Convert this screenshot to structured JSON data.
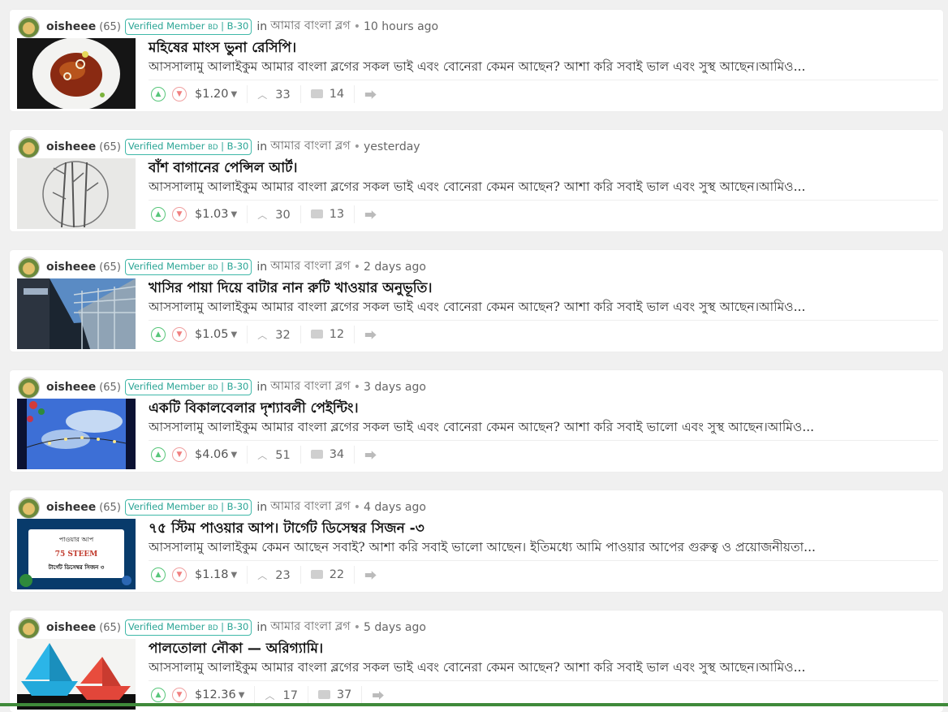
{
  "posts": [
    {
      "author": "oisheee",
      "rep": "(65)",
      "badge_main": "Verified Member ",
      "badge_small": "BD",
      "badge_tail": " | B-30",
      "in": "in",
      "community": "আমার বাংলা ব্লগ",
      "time": "10 hours ago",
      "title": "মহিষের মাংস ভুনা রেসিপি।",
      "excerpt": "আসসালামু আলাইকুম আমার বাংলা ব্লগের সকল ভাই এবং বোনেরা কেমন আছেন? আশা করি সবাই ভাল এবং সুস্থ আছেন।আমিও...",
      "payout": "$1.20",
      "votes": "33",
      "comments": "14",
      "thumb": "food"
    },
    {
      "author": "oisheee",
      "rep": "(65)",
      "badge_main": "Verified Member ",
      "badge_small": "BD",
      "badge_tail": " | B-30",
      "in": "in",
      "community": "আমার বাংলা ব্লগ",
      "time": "yesterday",
      "title": "বাঁশ বাগানের পেন্সিল আর্ট।",
      "excerpt": "আসসালামু আলাইকুম আমার বাংলা ব্লগের সকল ভাই এবং বোনেরা কেমন আছেন? আশা করি সবাই ভাল এবং সুস্থ আছেন।আমিও...",
      "payout": "$1.03",
      "votes": "30",
      "comments": "13",
      "thumb": "pencil"
    },
    {
      "author": "oisheee",
      "rep": "(65)",
      "badge_main": "Verified Member ",
      "badge_small": "BD",
      "badge_tail": " | B-30",
      "in": "in",
      "community": "আমার বাংলা ব্লগ",
      "time": "2 days ago",
      "title": "খাসির পায়া দিয়ে বাটার নান রুটি খাওয়ার অনুভূতি।",
      "excerpt": "আসসালামু আলাইকুম আমার বাংলা ব্লগের সকল ভাই এবং বোনেরা কেমন আছেন? আশা করি সবাই ভাল এবং সুস্থ আছেন।আমিও...",
      "payout": "$1.05",
      "votes": "32",
      "comments": "12",
      "thumb": "bridge"
    },
    {
      "author": "oisheee",
      "rep": "(65)",
      "badge_main": "Verified Member ",
      "badge_small": "BD",
      "badge_tail": " | B-30",
      "in": "in",
      "community": "আমার বাংলা ব্লগ",
      "time": "3 days ago",
      "title": "একটি বিকালবেলার দৃশ্যাবলী পেইন্টিং।",
      "excerpt": "আসসালামু আলাইকুম আমার বাংলা ব্লগের সকল ভাই এবং বোনেরা কেমন আছেন? আশা করি সবাই ভালো এবং সুস্থ আছেন।আমিও...",
      "payout": "$4.06",
      "votes": "51",
      "comments": "34",
      "thumb": "painting"
    },
    {
      "author": "oisheee",
      "rep": "(65)",
      "badge_main": "Verified Member ",
      "badge_small": "BD",
      "badge_tail": " | B-30",
      "in": "in",
      "community": "আমার বাংলা ব্লগ",
      "time": "4 days ago",
      "title": "৭৫ স্টিম পাওয়ার আপ। টার্গেট ডিসেম্বর সিজন -৩",
      "excerpt": "আসসালামু আলাইকুম কেমন আছেন সবাই? আশা করি সবাই ভালো আছেন। ইতিমধ্যে আমি পাওয়ার আপের গুরুত্ব ও প্রয়োজনীয়তা...",
      "payout": "$1.18",
      "votes": "23",
      "comments": "22",
      "thumb": "powerup",
      "thumb_text": {
        "line1": "পাওয়ার আপ",
        "line2": "75 STEEM",
        "line3": "টার্গেট ডিসেম্বর সিজন ৩"
      }
    },
    {
      "author": "oisheee",
      "rep": "(65)",
      "badge_main": "Verified Member ",
      "badge_small": "BD",
      "badge_tail": " | B-30",
      "in": "in",
      "community": "আমার বাংলা ব্লগ",
      "time": "5 days ago",
      "title": "পালতোলা নৌকা — অরিগ্যামি।",
      "excerpt": "আসসালামু আলাইকুম আমার বাংলা ব্লগের সকল ভাই এবং বোনেরা কেমন আছেন? আশা করি সবাই ভাল এবং সুস্থ আছেন।আমিও...",
      "payout": "$12.36",
      "votes": "17",
      "comments": "37",
      "thumb": "boats"
    }
  ],
  "colors": {
    "upvote": "#57c67a",
    "downvote": "#f08080",
    "badge": "#2aa595",
    "bottom_bar": "#3f8a3a"
  },
  "icons": {
    "upvote": "chevron-up-circle-icon",
    "downvote": "chevron-down-circle-icon",
    "comments": "comment-bubble-icon",
    "resteem": "resteem-icon"
  }
}
